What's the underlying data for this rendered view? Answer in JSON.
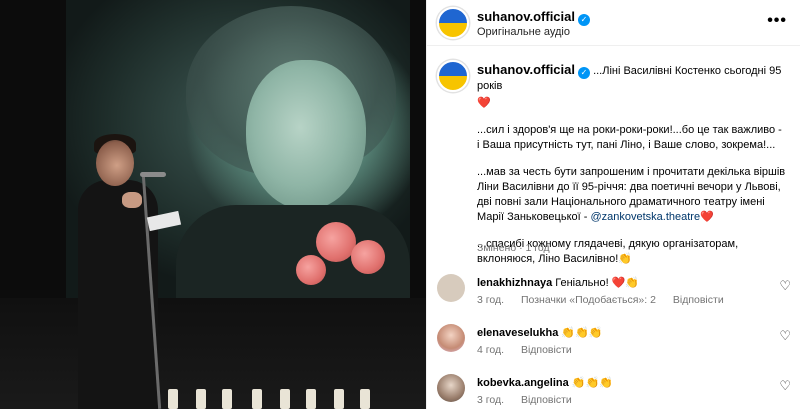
{
  "post": {
    "username": "suhanov.official",
    "audio_label": "Оригінальне аудіо",
    "more_icon": "•••"
  },
  "caption": {
    "username": "suhanov.official",
    "line1": "...Ліні Василівні Костенко сьогодні 95 років",
    "para2": "...сил і здоров'я ще на роки-роки-роки!...бо це так важливо - і Ваша присутність тут, пані Ліно, і Ваше слово, зокрема!...",
    "para3a": "...мав за честь бути запрошеним і прочитати декілька віршів Ліни Василівни до її 95-річчя: два поетичні вечори у Львові, дві повні зали Національного драматичного театру імені Марії Заньковецької - ",
    "para3_mention": "@zankovetska.theatre",
    "para4": "...спасибі кожному глядачеві, дякую організаторам, вклоняюся, Ліно Василівно!",
    "edited": "Змінено",
    "separator": "·",
    "time": "1 год"
  },
  "comments": [
    {
      "username": "lenakhizhnaya",
      "text": "Геніально!",
      "emojis": "❤️👏",
      "time": "3 год.",
      "likes": "Позначки «Подобається»: 2",
      "reply": "Відповісти"
    },
    {
      "username": "elenaveselukha",
      "text": "",
      "emojis": "👏👏👏",
      "time": "4 год.",
      "likes": "",
      "reply": "Відповісти"
    },
    {
      "username": "kobevka.angelina",
      "text": "",
      "emojis": "👏👏👏",
      "time": "3 год.",
      "likes": "",
      "reply": "Відповісти"
    }
  ],
  "icons": {
    "verified": "✓",
    "like": "♡",
    "heart": "❤️",
    "clap": "👏"
  },
  "colors": {
    "link": "#00376b",
    "meta": "#737373",
    "verified": "#0095f6"
  }
}
